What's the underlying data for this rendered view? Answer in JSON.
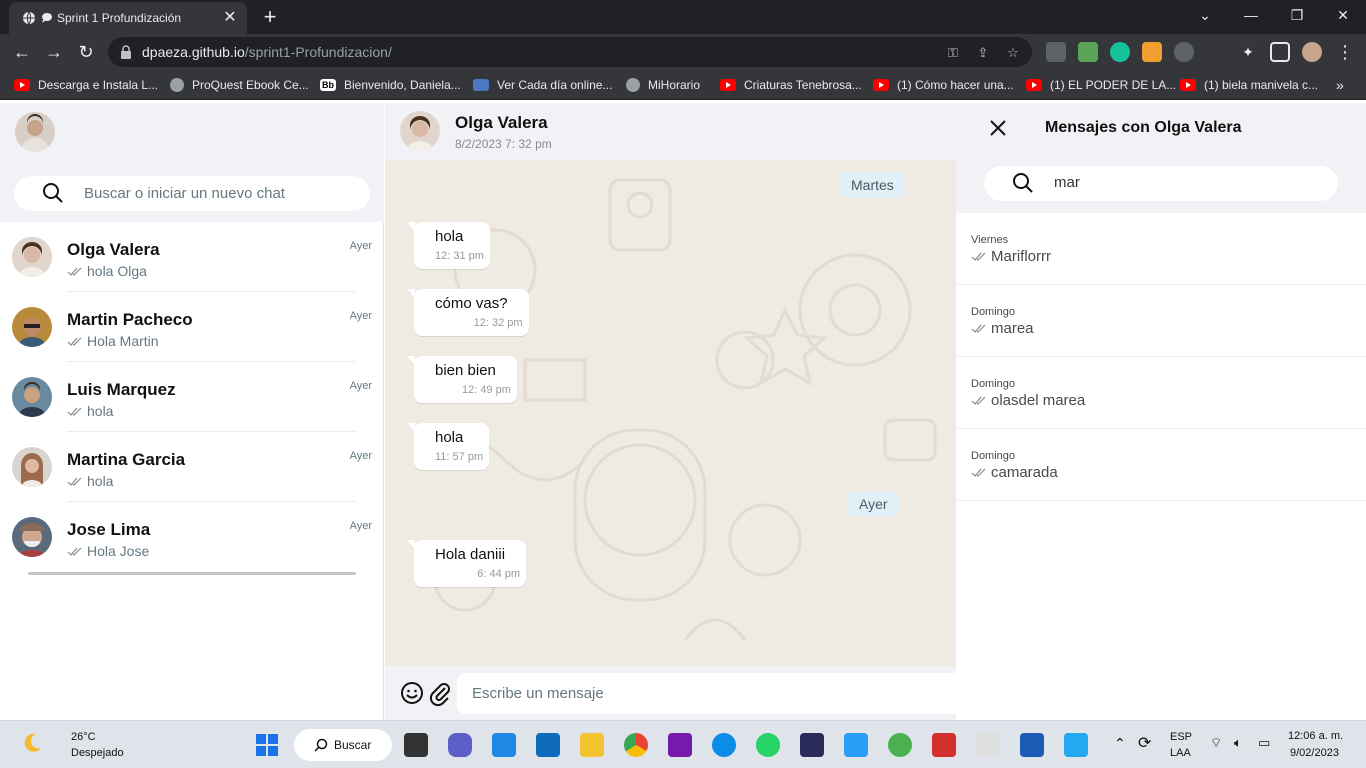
{
  "browser": {
    "tab_title": "Sprint 1 Profundización",
    "url_host": "dpaeza.github.io",
    "url_path": "/sprint1-Profundizacion/",
    "bookmarks": [
      "Descarga e Instala L...",
      "ProQuest Ebook Ce...",
      "Bienvenido, Daniela...",
      "Ver Cada día online...",
      "MiHorario",
      "Criaturas Tenebrosa...",
      "(1) Cómo hacer una...",
      "(1) EL PODER DE LA...",
      "(1) biela manivela c..."
    ],
    "bookmark_icons": [
      "yt",
      "globe",
      "bb",
      "vc",
      "globe",
      "yt",
      "yt",
      "yt",
      "yt"
    ]
  },
  "sidebar": {
    "search_placeholder": "Buscar o iniciar un nuevo chat",
    "chats": [
      {
        "name": "Olga Valera",
        "last": "hola Olga",
        "time": "Ayer",
        "color": "#d9b9a5"
      },
      {
        "name": "Martin Pacheco",
        "last": "Hola Martin",
        "time": "Ayer",
        "color": "#8a6a4a"
      },
      {
        "name": "Luis Marquez",
        "last": "hola",
        "time": "Ayer",
        "color": "#4a6a8a"
      },
      {
        "name": "Martina Garcia",
        "last": "hola",
        "time": "Ayer",
        "color": "#c9a48c"
      },
      {
        "name": "Jose Lima",
        "last": "Hola Jose",
        "time": "Ayer",
        "color": "#7a7a7a"
      }
    ]
  },
  "conversation": {
    "contact_name": "Olga Valera",
    "last_seen": "8/2/2023 7: 32 pm",
    "date_chip_1": "Martes",
    "date_chip_2": "Ayer",
    "messages": [
      {
        "text": "hola",
        "time": "12: 31 pm"
      },
      {
        "text": "cómo vas?",
        "time": "12: 32 pm"
      },
      {
        "text": "bien bien",
        "time": "12: 49 pm"
      },
      {
        "text": "hola",
        "time": "11: 57 pm"
      },
      {
        "text": "Hola daniii",
        "time": "6: 44 pm"
      }
    ],
    "input_placeholder": "Escribe un mensaje"
  },
  "search_panel": {
    "title": "Mensajes con Olga Valera",
    "query": "mar",
    "results": [
      {
        "day": "Viernes",
        "text": "Mariflorrr"
      },
      {
        "day": "Domingo",
        "text": "marea"
      },
      {
        "day": "Domingo",
        "text": "olasdel marea"
      },
      {
        "day": "Domingo",
        "text": "camarada"
      }
    ]
  },
  "taskbar": {
    "temperature": "26°C",
    "weather": "Despejado",
    "search_label": "Buscar",
    "lang_1": "ESP",
    "lang_2": "LAA",
    "time": "12:06 a. m.",
    "date": "9/02/2023"
  }
}
